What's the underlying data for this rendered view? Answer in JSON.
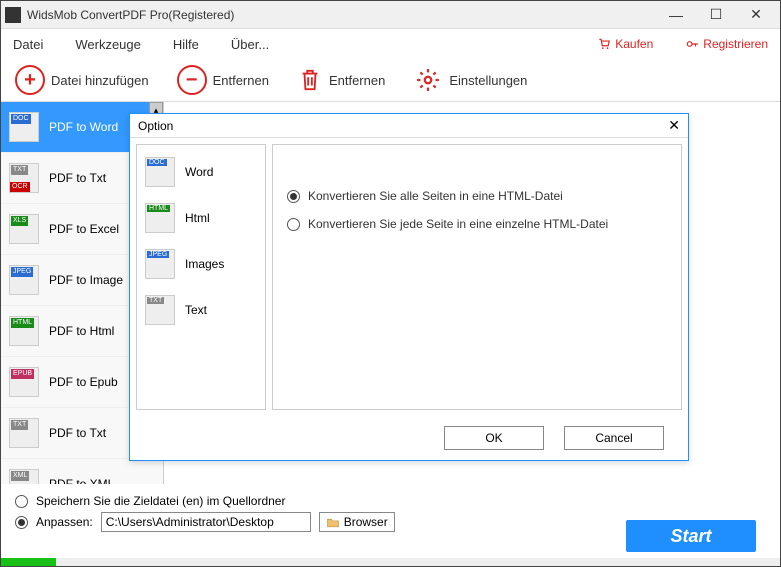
{
  "window": {
    "title": "WidsMob ConvertPDF Pro(Registered)"
  },
  "menu": {
    "file": "Datei",
    "tools": "Werkzeuge",
    "help": "Hilfe",
    "about": "Über...",
    "buy": "Kaufen",
    "register": "Registrieren"
  },
  "toolbar": {
    "add": "Datei hinzufügen",
    "remove": "Entfernen",
    "delete": "Entfernen",
    "settings": "Einstellungen"
  },
  "sidebar": {
    "items": [
      {
        "tag": "DOC",
        "color": "#2a6bd4",
        "label": "PDF to Word",
        "selected": true
      },
      {
        "tag": "TXT",
        "color": "#888",
        "label": "PDF to Txt",
        "ocr": true
      },
      {
        "tag": "XLS",
        "color": "#1a8a1a",
        "label": "PDF to Excel"
      },
      {
        "tag": "JPEG",
        "color": "#2a6bd4",
        "label": "PDF to Image"
      },
      {
        "tag": "HTML",
        "color": "#1a8a1a",
        "label": "PDF to Html"
      },
      {
        "tag": "EPUB",
        "color": "#c03060",
        "label": "PDF to Epub"
      },
      {
        "tag": "TXT",
        "color": "#888",
        "label": "PDF to Txt"
      },
      {
        "tag": "XML",
        "color": "#888",
        "label": "PDF to XML"
      }
    ]
  },
  "bottom": {
    "save_in_source": "Speichern Sie die Zieldatei (en) im Quellordner",
    "custom": "Anpassen:",
    "path": "C:\\Users\\Administrator\\Desktop",
    "browse": "Browser",
    "start": "Start"
  },
  "dialog": {
    "title": "Option",
    "left": [
      {
        "tag": "DOC",
        "color": "#2a6bd4",
        "label": "Word"
      },
      {
        "tag": "HTML",
        "color": "#1a8a1a",
        "label": "Html"
      },
      {
        "tag": "JPEG",
        "color": "#2a6bd4",
        "label": "Images"
      },
      {
        "tag": "TXT",
        "color": "#888",
        "label": "Text"
      }
    ],
    "opt_all": "Konvertieren Sie alle Seiten in eine HTML-Datei",
    "opt_each": "Konvertieren Sie jede Seite in eine einzelne HTML-Datei",
    "ok": "OK",
    "cancel": "Cancel"
  }
}
